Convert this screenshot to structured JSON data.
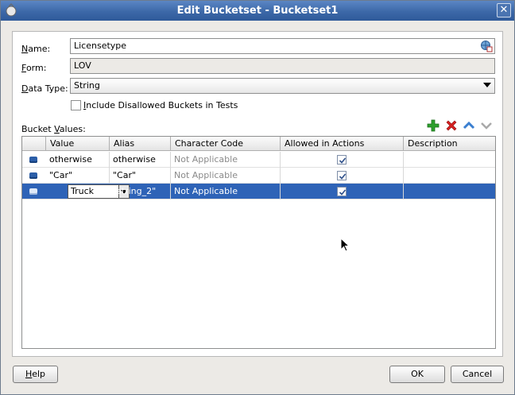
{
  "window": {
    "title": "Edit Bucketset - Bucketset1",
    "close_glyph": "✕"
  },
  "form": {
    "name_label_mnemonic": "N",
    "name_label_rest": "ame:",
    "name_value": "Licensetype",
    "form_label_mnemonic": "F",
    "form_label_rest": "orm:",
    "form_value": "LOV",
    "datatype_label_mnemonic": "D",
    "datatype_label_rest": "ata Type:",
    "datatype_value": "String",
    "include_label_mnemonic": "I",
    "include_label_rest": "nclude Disallowed Buckets in Tests",
    "include_checked": false
  },
  "bucket_values": {
    "label_prefix": "Bucket ",
    "label_mnemonic": "V",
    "label_rest": "alues:",
    "toolbar_icons": [
      "add-icon",
      "delete-icon",
      "move-up-icon",
      "move-down-icon"
    ],
    "columns": [
      "Value",
      "Alias",
      "Character Code",
      "Allowed in Actions",
      "Description"
    ],
    "rows": [
      {
        "value": "otherwise",
        "alias": "otherwise",
        "char_code": "Not Applicable",
        "allowed": true,
        "description": ""
      },
      {
        "value": "\"Car\"",
        "alias": "\"Car\"",
        "char_code": "Not Applicable",
        "allowed": true,
        "description": ""
      },
      {
        "value": "Truck",
        "alias": "\"string_2\"",
        "char_code": "Not Applicable",
        "allowed": true,
        "description": "",
        "selected": true
      }
    ]
  },
  "buttons": {
    "help_mnemonic": "H",
    "help_rest": "elp",
    "ok": "OK",
    "cancel": "Cancel"
  },
  "colors": {
    "titlebar": "#3c68a8",
    "selection": "#2e63b7",
    "add": "#2ea02e",
    "delete": "#d62020",
    "arrow": "#3b7fd0"
  }
}
